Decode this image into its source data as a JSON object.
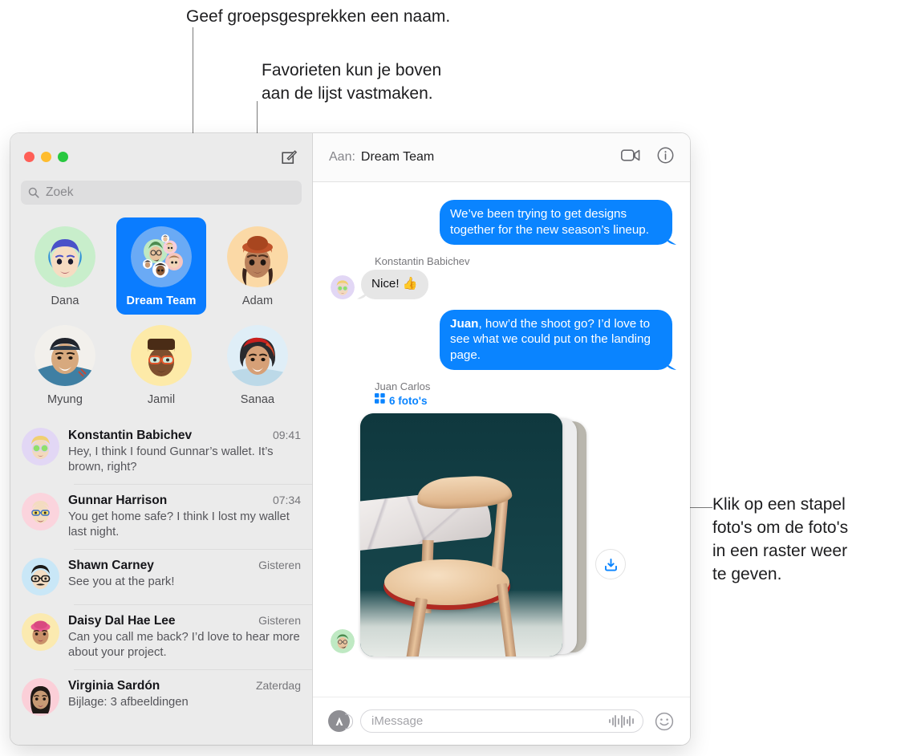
{
  "callouts": {
    "top_left": "Geef groepsgesprekken een naam.",
    "top_right": "Favorieten kun je boven\naan de lijst vastmaken.",
    "right": "Klik op een stapel\nfoto's om de foto's\nin een raster weer\nte geven."
  },
  "window": {
    "traffic_lights": [
      "close-red",
      "minimize-yellow",
      "zoom-green"
    ],
    "compose_icon": "compose-icon"
  },
  "sidebar": {
    "search": {
      "placeholder": "Zoek",
      "icon": "search-icon"
    },
    "pinned": [
      {
        "label": "Dana",
        "selected": false,
        "avatar": "memoji-dana"
      },
      {
        "label": "Dream Team",
        "selected": true,
        "avatar": "group-avatar-dream-team"
      },
      {
        "label": "Adam",
        "selected": false,
        "avatar": "memoji-adam"
      },
      {
        "label": "Myung",
        "selected": false,
        "avatar": "photo-myung"
      },
      {
        "label": "Jamil",
        "selected": false,
        "avatar": "memoji-jamil"
      },
      {
        "label": "Sanaa",
        "selected": false,
        "avatar": "photo-sanaa"
      }
    ],
    "conversations": [
      {
        "name": "Konstantin Babichev",
        "time": "09:41",
        "preview": "Hey, I think I found Gunnar’s wallet. It’s brown, right?",
        "avatar": "memoji-konstantin"
      },
      {
        "name": "Gunnar Harrison",
        "time": "07:34",
        "preview": "You get home safe? I think I lost my wallet last night.",
        "avatar": "memoji-gunnar"
      },
      {
        "name": "Shawn Carney",
        "time": "Gisteren",
        "preview": "See you at the park!",
        "avatar": "memoji-shawn"
      },
      {
        "name": "Daisy Dal Hae Lee",
        "time": "Gisteren",
        "preview": "Can you call me back? I’d love to hear more about your project.",
        "avatar": "memoji-daisy"
      },
      {
        "name": "Virginia Sardón",
        "time": "Zaterdag",
        "preview": "Bijlage:  3 afbeeldingen",
        "avatar": "memoji-virginia"
      }
    ]
  },
  "thread": {
    "to_label": "Aan:",
    "title": "Dream Team",
    "facetime_icon": "video-camera-icon",
    "info_icon": "info-circle-icon",
    "messages": [
      {
        "direction": "out",
        "text": "We’ve been trying to get designs together for the new season’s lineup."
      },
      {
        "direction": "in",
        "sender": "Konstantin Babichev",
        "text": "Nice!  👍",
        "avatar": "memoji-konstantin"
      },
      {
        "direction": "out",
        "bold_prefix": "Juan",
        "text": ", how’d the shoot go? I’d love to see what we could put on the landing page."
      }
    ],
    "photo_attachment": {
      "sender": "Juan Carlos",
      "count_label": "6 foto's",
      "grid_icon": "photo-grid-icon",
      "avatar": "memoji-juan-carlos",
      "download_icon": "download-icon"
    },
    "compose": {
      "appstore_icon": "app-store-icon",
      "placeholder": "iMessage",
      "audio_icon": "audio-waveform-icon",
      "emoji_icon": "emoji-smiley-icon"
    }
  },
  "colors": {
    "accent_blue": "#0a84ff",
    "selected_blue": "#0a7cff",
    "sidebar_bg": "#ebebeb",
    "incoming_bubble": "#e6e6e6"
  }
}
